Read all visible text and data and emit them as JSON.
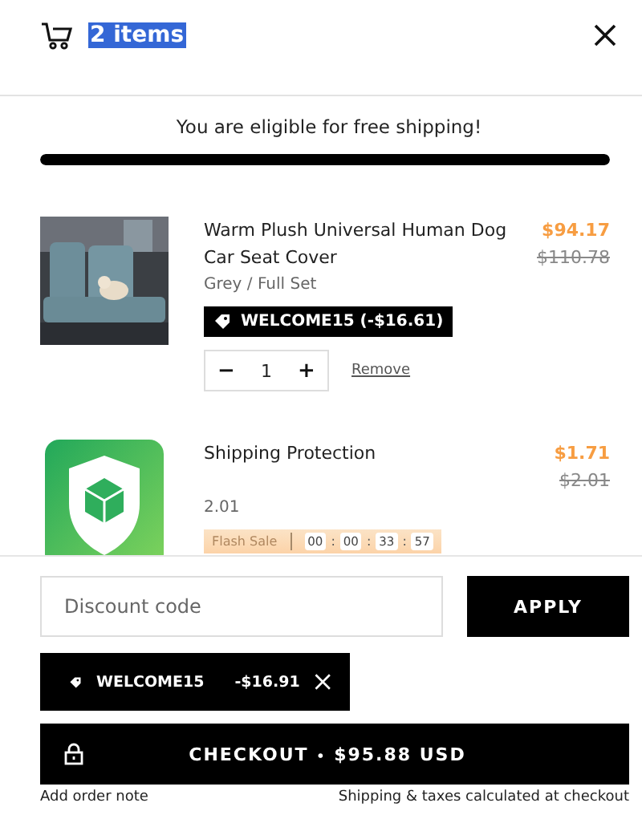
{
  "header": {
    "title": "2 items",
    "title_selected": true
  },
  "shipping": {
    "message": "You are eligible for free shipping!",
    "level": 1
  },
  "items": [
    {
      "kind": "product",
      "title": "Warm Plush Universal Human Dog Car Seat Cover",
      "price": "$94.17",
      "compare_price": "$110.78",
      "variant": "Grey / Full Set",
      "discount": "WELCOME15 (-$16.61)",
      "minus": "−",
      "quantity": "1",
      "plus": "+",
      "remove": "Remove"
    },
    {
      "kind": "protection",
      "title": "Shipping Protection",
      "price": "$1.71",
      "compare_price": "$2.01",
      "variant": "2.01",
      "flash_label": "Flash Sale",
      "timer": [
        "00",
        "00",
        "33",
        "57"
      ],
      "separator": ":"
    }
  ],
  "discount_field": {
    "placeholder": "Discount code"
  },
  "apply_button": "APPLY",
  "applied_code": {
    "code": "WELCOME15",
    "amount": "-$16.91"
  },
  "checkout": {
    "label": "CHECKOUT",
    "dot": "•",
    "total": "$95.88 USD"
  },
  "footer": {
    "note_link": "Add order note",
    "tax_note": "Shipping & taxes calculated at checkout"
  }
}
